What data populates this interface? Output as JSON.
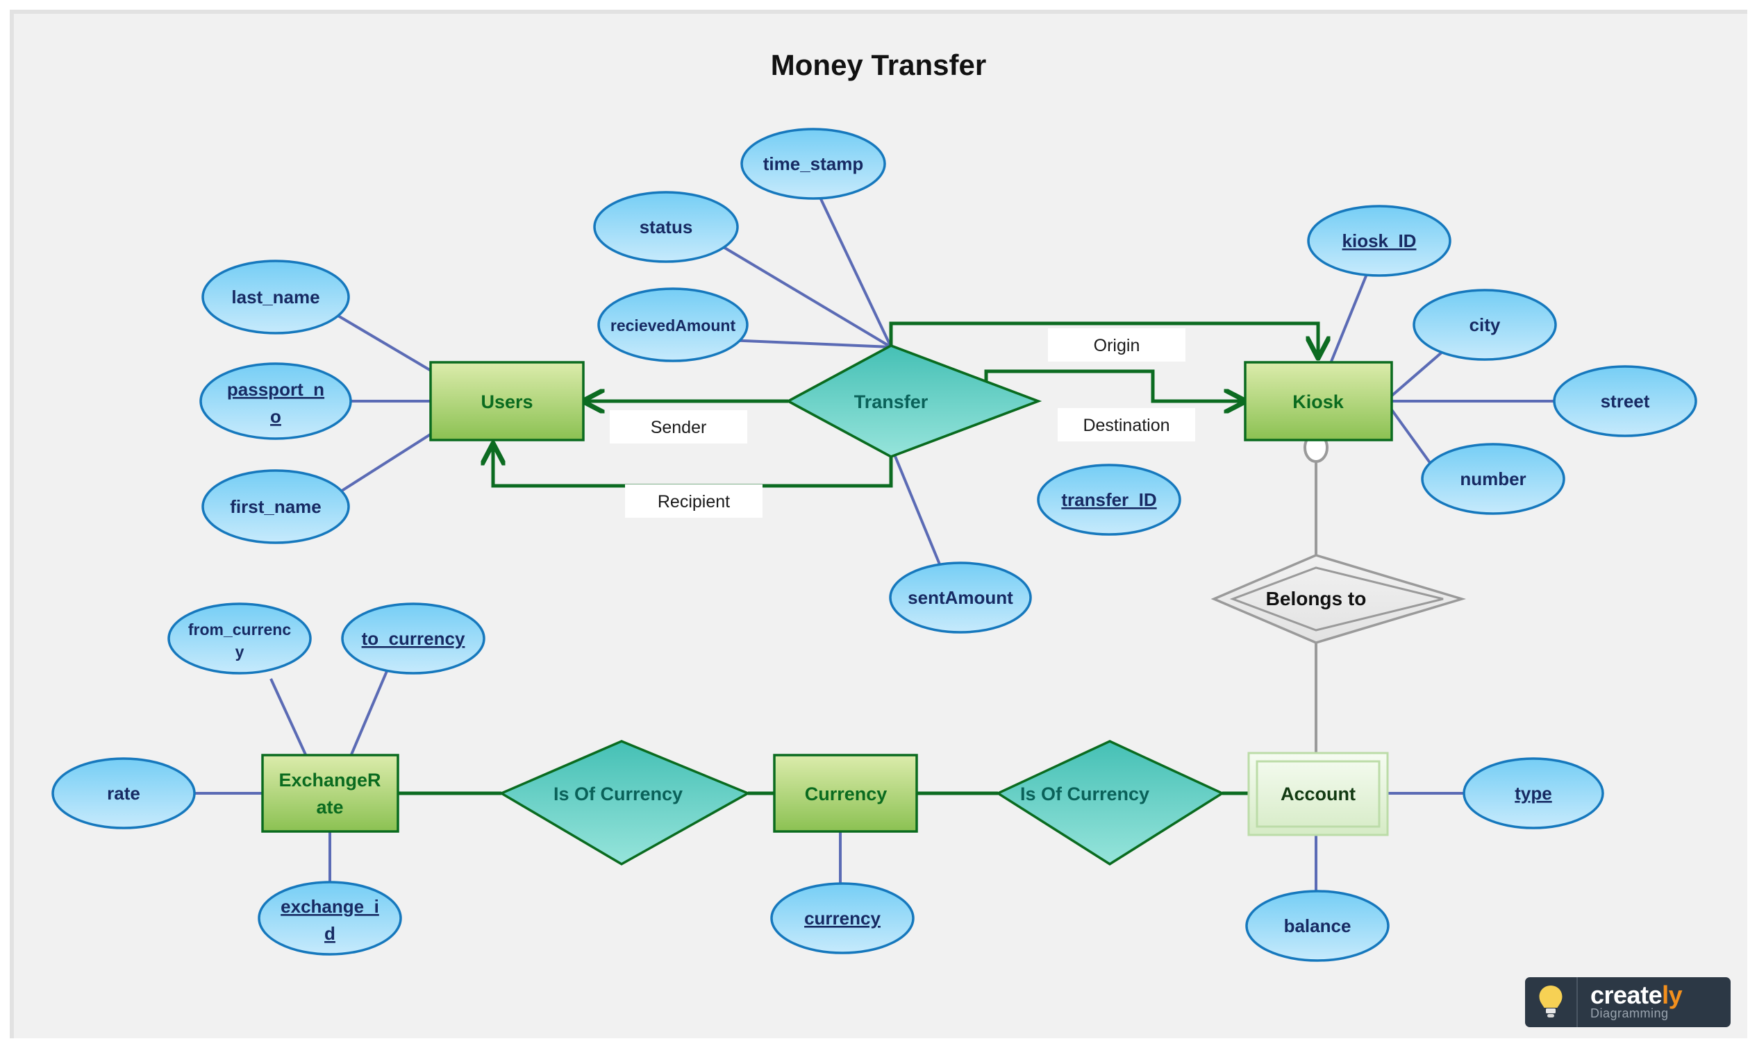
{
  "title": "Money Transfer",
  "diagram": {
    "kind": "entity-relationship-diagram",
    "entities": [
      {
        "id": "users",
        "label": "Users",
        "weak": false
      },
      {
        "id": "kiosk",
        "label": "Kiosk",
        "weak": false
      },
      {
        "id": "exchangerate",
        "label": "ExchangeRate",
        "line1": "ExchangeR",
        "line2": "ate",
        "weak": false
      },
      {
        "id": "currency",
        "label": "Currency",
        "weak": false
      },
      {
        "id": "account",
        "label": "Account",
        "weak": true
      }
    ],
    "relationships": [
      {
        "id": "transfer",
        "label": "Transfer",
        "style": "teal"
      },
      {
        "id": "belongs-to",
        "label": "Belongs to",
        "style": "gray-identifying"
      },
      {
        "id": "is-of-currency-left",
        "label": "Is Of Currency",
        "style": "teal"
      },
      {
        "id": "is-of-currency-right",
        "label": "Is Of Currency",
        "style": "teal"
      }
    ],
    "attributes": [
      {
        "id": "last-name",
        "label": "last_name",
        "key": false,
        "owner": "users"
      },
      {
        "id": "passport-no",
        "label": "passport_no",
        "line1": "passport_n",
        "line2": "o",
        "key": true,
        "owner": "users"
      },
      {
        "id": "first-name",
        "label": "first_name",
        "key": false,
        "owner": "users"
      },
      {
        "id": "time-stamp",
        "label": "time_stamp",
        "key": false,
        "owner": "transfer"
      },
      {
        "id": "status",
        "label": "status",
        "key": false,
        "owner": "transfer"
      },
      {
        "id": "recieved-amount",
        "label": "recievedAmount",
        "key": false,
        "owner": "transfer"
      },
      {
        "id": "transfer-id",
        "label": "transfer_ID",
        "key": true,
        "owner": "transfer"
      },
      {
        "id": "sent-amount",
        "label": "sentAmount",
        "key": false,
        "owner": "transfer"
      },
      {
        "id": "kiosk-id",
        "label": "kiosk_ID",
        "key": true,
        "owner": "kiosk"
      },
      {
        "id": "city",
        "label": "city",
        "key": false,
        "owner": "kiosk"
      },
      {
        "id": "street",
        "label": "street",
        "key": false,
        "owner": "kiosk"
      },
      {
        "id": "number",
        "label": "number",
        "key": false,
        "owner": "kiosk"
      },
      {
        "id": "from-currency",
        "label": "from_currency",
        "line1": "from_currenc",
        "line2": "y",
        "key": false,
        "owner": "exchangerate"
      },
      {
        "id": "to-currency",
        "label": "to_currency",
        "key": true,
        "owner": "exchangerate"
      },
      {
        "id": "rate",
        "label": "rate",
        "key": false,
        "owner": "exchangerate"
      },
      {
        "id": "exchange-id",
        "label": "exchange_id",
        "line1": "exchange_i",
        "line2": "d",
        "key": true,
        "owner": "exchangerate"
      },
      {
        "id": "currency-attr",
        "label": "currency",
        "key": true,
        "owner": "currency"
      },
      {
        "id": "type",
        "label": "type",
        "key": true,
        "owner": "account"
      },
      {
        "id": "balance",
        "label": "balance",
        "key": false,
        "owner": "account"
      }
    ],
    "edge_labels": [
      {
        "id": "sender",
        "label": "Sender"
      },
      {
        "id": "recipient",
        "label": "Recipient"
      },
      {
        "id": "origin",
        "label": "Origin"
      },
      {
        "id": "destination",
        "label": "Destination"
      }
    ]
  },
  "logo": {
    "word_main": "create",
    "word_accent": "ly",
    "tagline": "Diagramming"
  },
  "colors": {
    "canvas": "#f1f1f1",
    "entity_fill_top": "#d8e9a4",
    "entity_fill_bottom": "#8dc255",
    "entity_stroke": "#0a6b1f",
    "weak_entity_fill_top": "#f4fbf0",
    "weak_entity_fill_bottom": "#d8ecc8",
    "relationship_fill_top": "#45c0b5",
    "relationship_fill_bottom": "#93e2d9",
    "relationship_stroke": "#0a6b1f",
    "attribute_fill_top": "#77cff5",
    "attribute_fill_bottom": "#c3e9fb",
    "attribute_stroke": "#1678bd",
    "attribute_text": "#172a63",
    "link_blue": "#5b6bb5",
    "link_green": "#0c6b21",
    "link_gray": "#9a9a9a",
    "logo_bg": "#2c3845",
    "logo_accent": "#f3901d"
  }
}
